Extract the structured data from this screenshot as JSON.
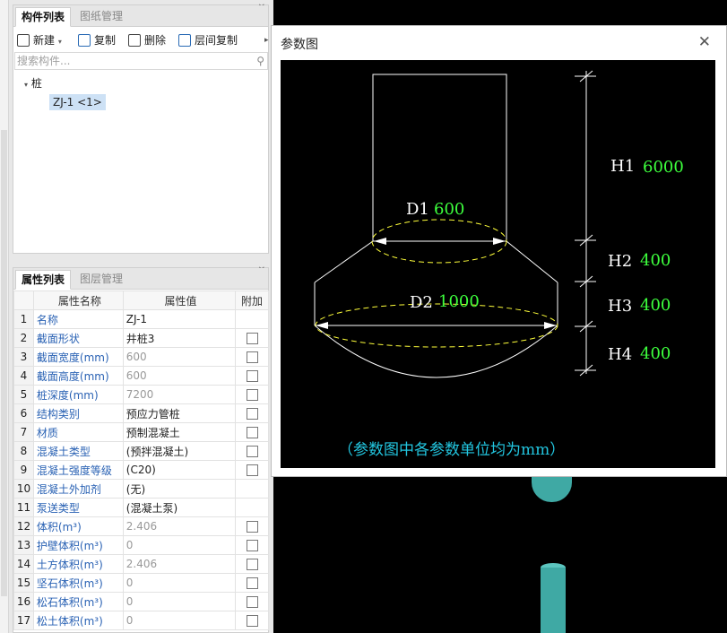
{
  "component_panel": {
    "tabs": [
      "构件列表",
      "图纸管理"
    ],
    "toolbar": {
      "new": "新建",
      "copy": "复制",
      "delete": "删除",
      "floor_copy": "层间复制"
    },
    "search_placeholder": "搜索构件...",
    "tree": {
      "root": "桩",
      "child": "ZJ-1 <1>"
    }
  },
  "props_panel": {
    "tabs": [
      "属性列表",
      "图层管理"
    ],
    "headers": [
      "属性名称",
      "属性值",
      "附加"
    ],
    "rows": [
      {
        "n": "1",
        "name": "名称",
        "value": "ZJ-1",
        "gray": false,
        "cb": false
      },
      {
        "n": "2",
        "name": "截面形状",
        "value": "井桩3",
        "gray": false,
        "cb": true
      },
      {
        "n": "3",
        "name": "截面宽度(mm)",
        "value": "600",
        "gray": true,
        "cb": true
      },
      {
        "n": "4",
        "name": "截面高度(mm)",
        "value": "600",
        "gray": true,
        "cb": true
      },
      {
        "n": "5",
        "name": "桩深度(mm)",
        "value": "7200",
        "gray": true,
        "cb": true
      },
      {
        "n": "6",
        "name": "结构类别",
        "value": "预应力管桩",
        "gray": false,
        "cb": true
      },
      {
        "n": "7",
        "name": "材质",
        "value": "预制混凝土",
        "gray": false,
        "cb": true
      },
      {
        "n": "8",
        "name": "混凝土类型",
        "value": "(预拌混凝土)",
        "gray": false,
        "cb": true
      },
      {
        "n": "9",
        "name": "混凝土强度等级",
        "value": "(C20)",
        "gray": false,
        "cb": true
      },
      {
        "n": "10",
        "name": "混凝土外加剂",
        "value": "(无)",
        "gray": false,
        "cb": false
      },
      {
        "n": "11",
        "name": "泵送类型",
        "value": "(混凝土泵)",
        "gray": false,
        "cb": false
      },
      {
        "n": "12",
        "name": "体积(m³)",
        "value": "2.406",
        "gray": true,
        "cb": true
      },
      {
        "n": "13",
        "name": "护壁体积(m³)",
        "value": "0",
        "gray": true,
        "cb": true
      },
      {
        "n": "14",
        "name": "土方体积(m³)",
        "value": "2.406",
        "gray": true,
        "cb": true
      },
      {
        "n": "15",
        "name": "坚石体积(m³)",
        "value": "0",
        "gray": true,
        "cb": true
      },
      {
        "n": "16",
        "name": "松石体积(m³)",
        "value": "0",
        "gray": true,
        "cb": true
      },
      {
        "n": "17",
        "name": "松土体积(m³)",
        "value": "0",
        "gray": true,
        "cb": true
      }
    ]
  },
  "dialog": {
    "title": "参数图",
    "labels": {
      "H1": "H1",
      "H1_val": "6000",
      "D1": "D1",
      "D1_val": "600",
      "H2": "H2",
      "H2_val": "400",
      "D2": "D2",
      "D2_val": "1000",
      "H3": "H3",
      "H3_val": "400",
      "H4": "H4",
      "H4_val": "400"
    },
    "note": "（参数图中各参数单位均为mm）"
  }
}
